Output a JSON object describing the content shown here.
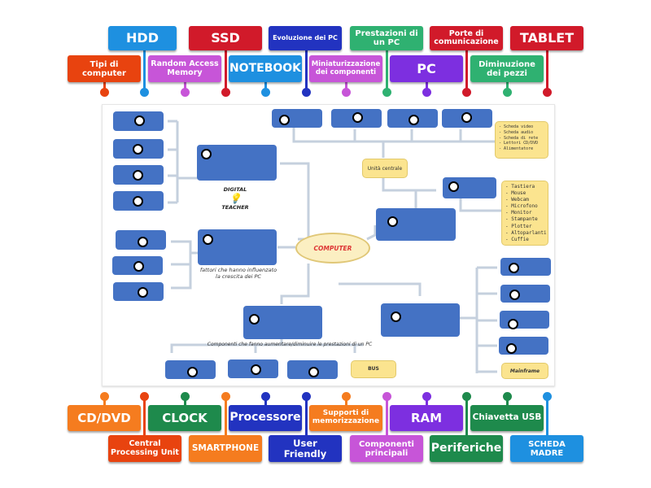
{
  "top_labels": [
    {
      "text": "HDD",
      "color": "#1e90e0",
      "row": "upper"
    },
    {
      "text": "SSD",
      "color": "#d11a2a",
      "row": "upper"
    },
    {
      "text": "Evoluzione dei PC",
      "color": "#2233c0",
      "row": "upper"
    },
    {
      "text": "Prestazioni di un PC",
      "color": "#2fb171",
      "row": "upper"
    },
    {
      "text": "Porte di comunicazione",
      "color": "#d11a2a",
      "row": "upper"
    },
    {
      "text": "TABLET",
      "color": "#d11a2a",
      "row": "upper"
    },
    {
      "text": "Tipi di computer",
      "color": "#e8430f",
      "row": "lower"
    },
    {
      "text": "Random Access Memory",
      "color": "#c755d8",
      "row": "lower"
    },
    {
      "text": "NOTEBOOK",
      "color": "#1e90e0",
      "row": "lower"
    },
    {
      "text": "Miniaturizzazione dei componenti",
      "color": "#c755d8",
      "row": "lower"
    },
    {
      "text": "PC",
      "color": "#7d2fe0",
      "row": "lower"
    },
    {
      "text": "Diminuzione dei pezzi",
      "color": "#2fb171",
      "row": "lower"
    }
  ],
  "bottom_labels": [
    {
      "text": "CD/DVD",
      "color": "#f57c1f"
    },
    {
      "text": "CLOCK",
      "color": "#1e8a4c"
    },
    {
      "text": "Processore",
      "color": "#2233c0"
    },
    {
      "text": "Supporti di memorizzazione",
      "color": "#f57c1f"
    },
    {
      "text": "RAM",
      "color": "#7d2fe0"
    },
    {
      "text": "Chiavetta USB",
      "color": "#1e8a4c"
    },
    {
      "text": "Central Processing Unit",
      "color": "#e8430f"
    },
    {
      "text": "SMARTPHONE",
      "color": "#f57c1f"
    },
    {
      "text": "User Friendly",
      "color": "#2233c0"
    },
    {
      "text": "Componenti principali",
      "color": "#c755d8"
    },
    {
      "text": "Periferiche",
      "color": "#1e8a4c"
    },
    {
      "text": "SCHEDA MADRE",
      "color": "#1e90e0"
    }
  ],
  "diagram": {
    "center": "COMPUTER",
    "logo_top": "DIGITAL",
    "logo_bottom": "TEACHER",
    "caption_factors": "fattori che hanno influenzato\nla crescita dei PC",
    "caption_components": "Componenti che fanno aumentare/diminuire le prestazioni di un PC",
    "unita_centrale": "Unità centrale",
    "bus": "BUS",
    "mainframe": "Mainframe",
    "schede_list": "- Scheda video\n- Scheda audio\n- Scheda di rete\n- Lettori CD/DVD\n- Alimentatore",
    "periferiche_list": "- Tastiera\n- Mouse\n- Webcam\n- Microfono\n- Monitor\n- Stampante\n- Plotter\n- Altoparlanti\n- Cuffie"
  }
}
